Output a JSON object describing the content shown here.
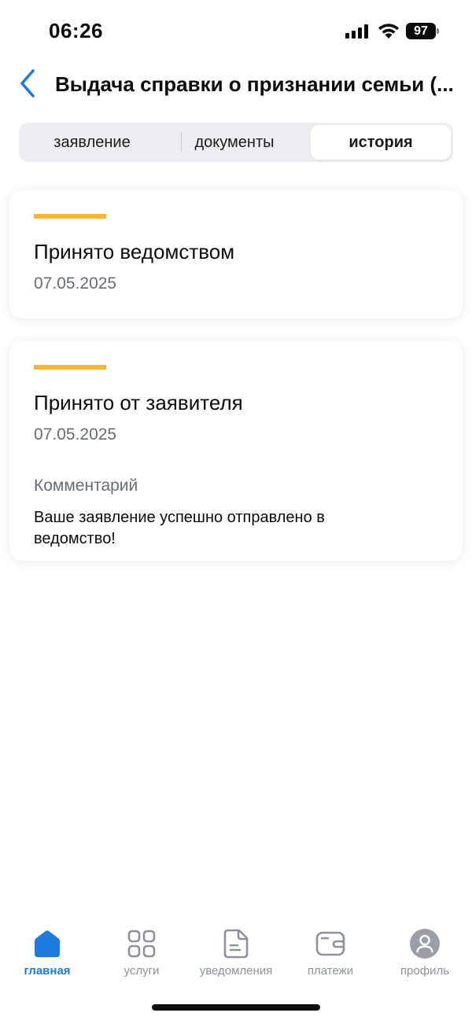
{
  "status_bar": {
    "time": "06:26",
    "battery": "97"
  },
  "header": {
    "title": "Выдача справки о признании семьи (..."
  },
  "tabs": [
    {
      "label": "заявление"
    },
    {
      "label": "документы"
    },
    {
      "label": "история",
      "active": true
    }
  ],
  "history": [
    {
      "status": "Принято ведомством",
      "date": "07.05.2025"
    },
    {
      "status": "Принято от заявителя",
      "date": "07.05.2025",
      "comment_label": "Комментарий",
      "comment": "Ваше заявление успешно отправлено в ведомство!"
    }
  ],
  "bottom_nav": [
    {
      "label": "главная",
      "icon": "home-icon",
      "active": true
    },
    {
      "label": "услуги",
      "icon": "grid-icon"
    },
    {
      "label": "уведомления",
      "icon": "document-icon"
    },
    {
      "label": "платежи",
      "icon": "wallet-icon"
    },
    {
      "label": "профиль",
      "icon": "user-icon"
    }
  ],
  "colors": {
    "accent": "#1f7ae0",
    "status_bar_accent": "#f5b733",
    "muted": "#8c919c"
  }
}
